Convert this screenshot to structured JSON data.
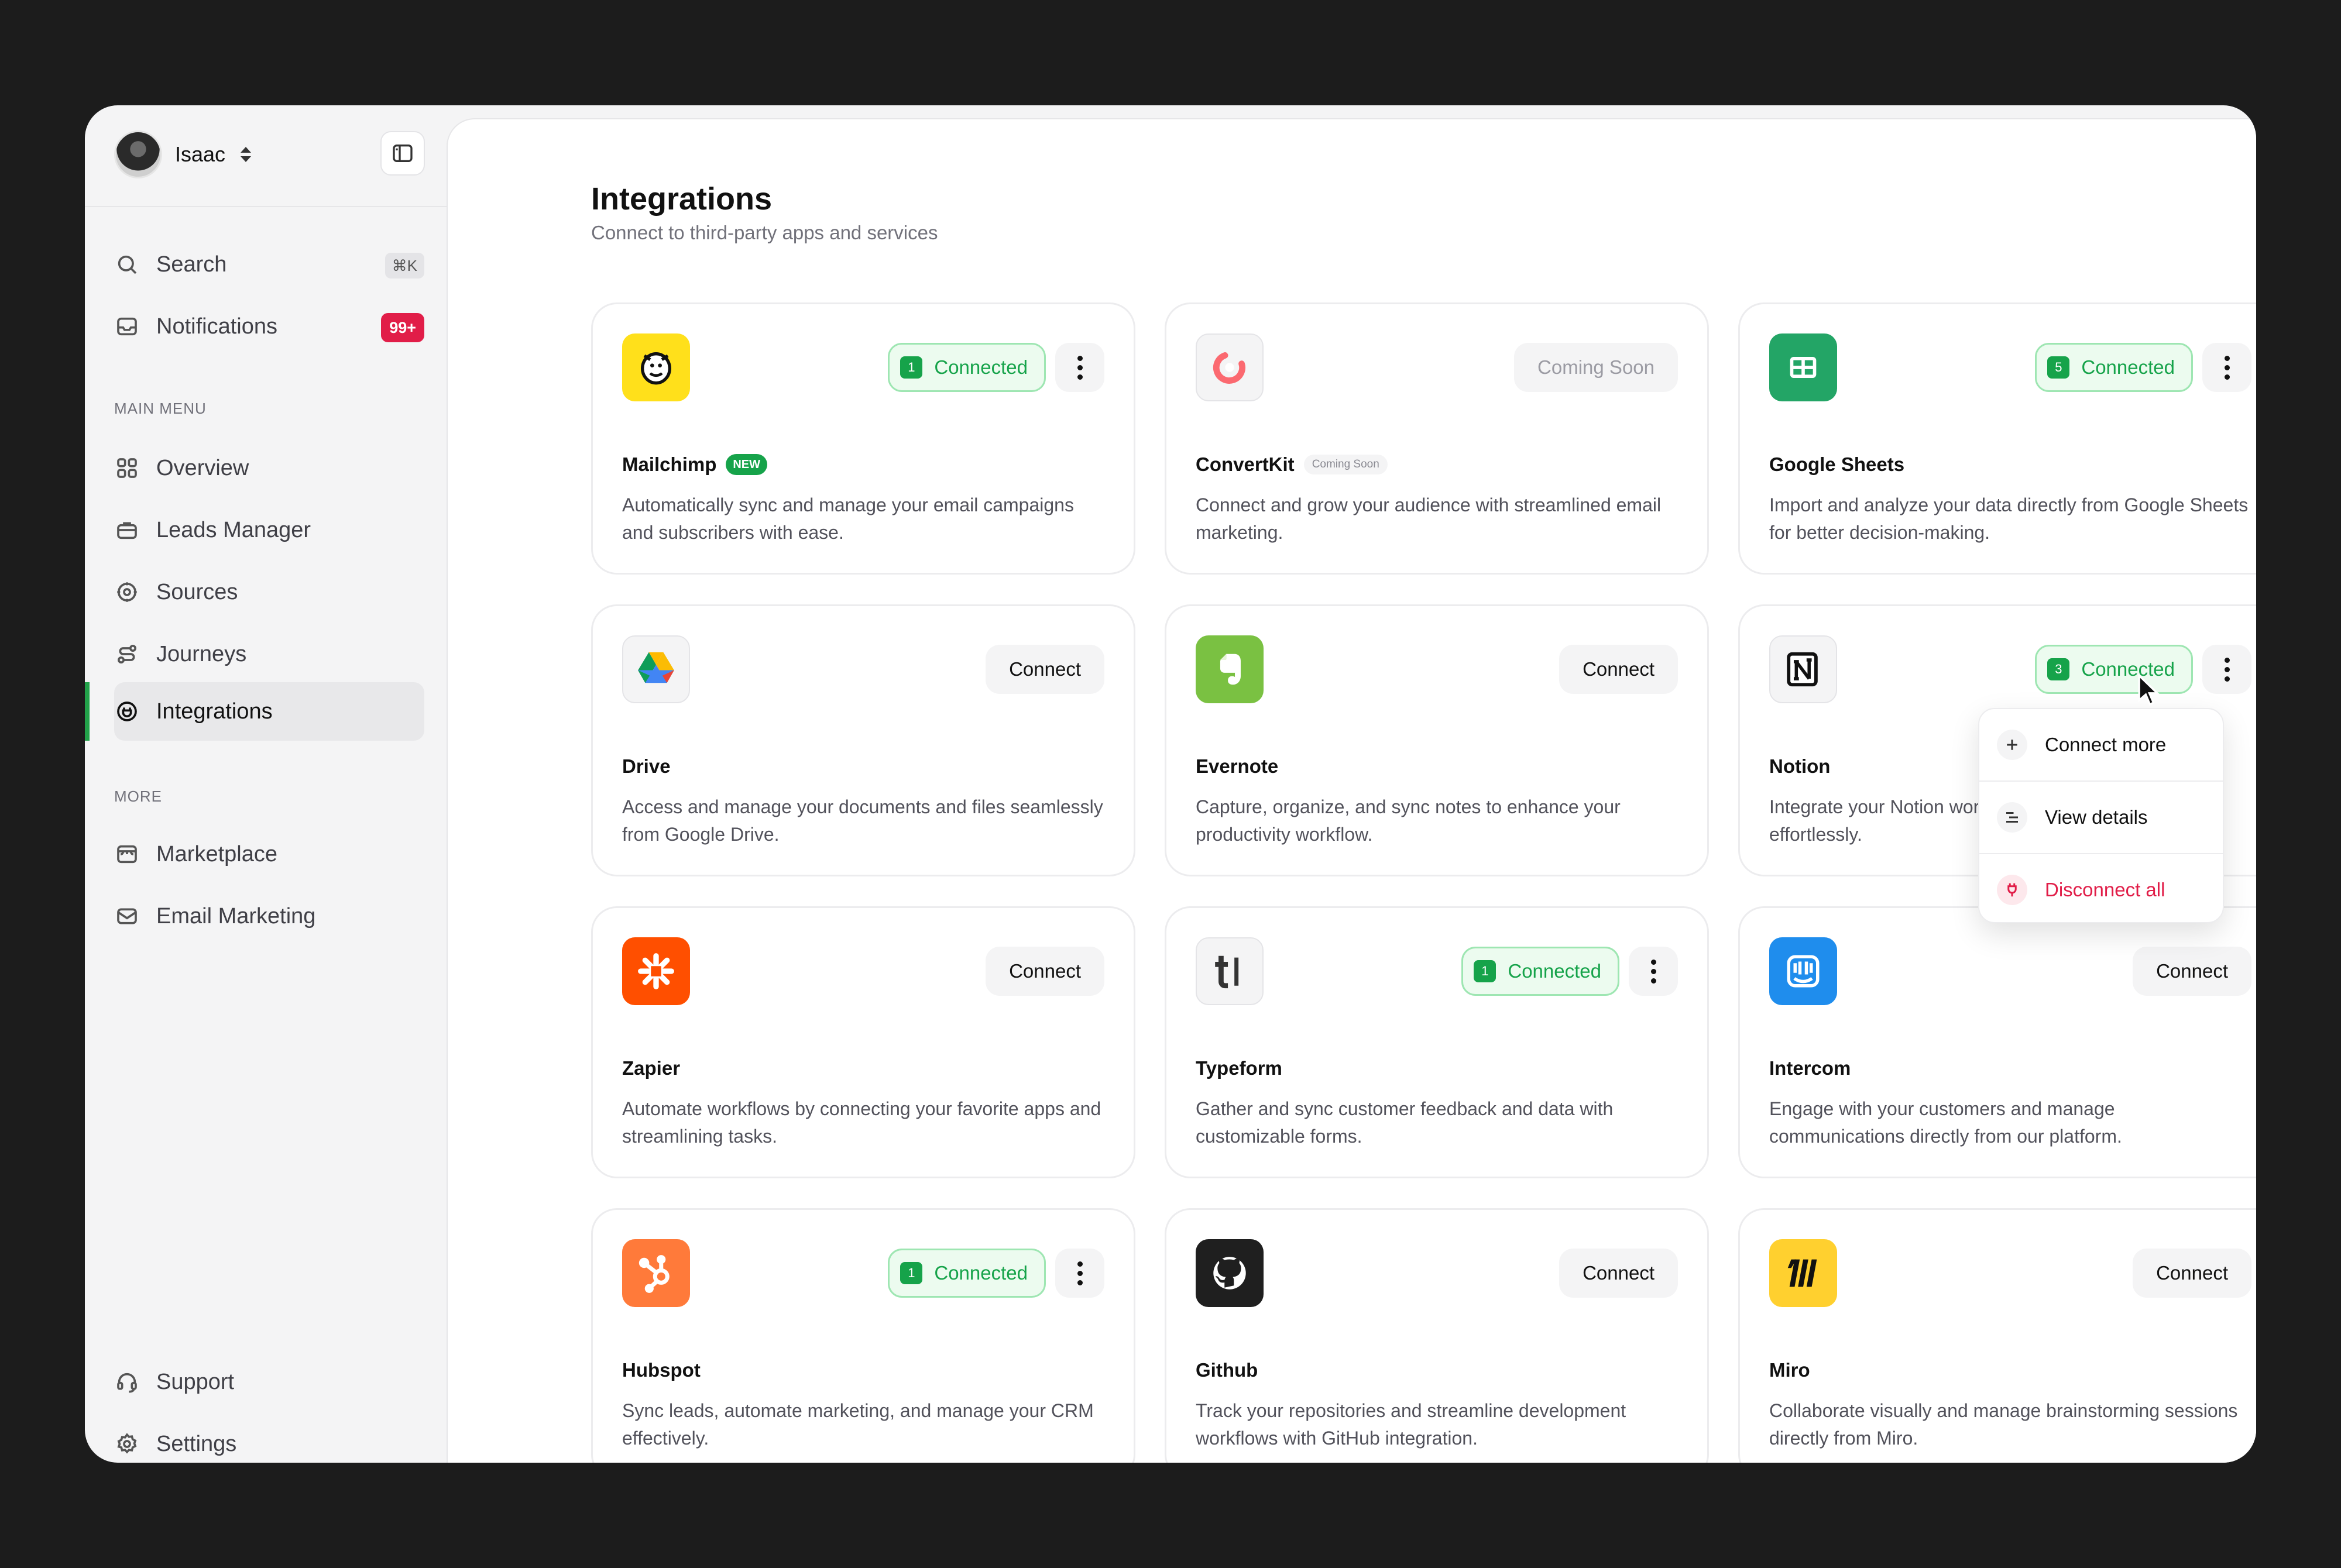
{
  "user": {
    "name": "Isaac"
  },
  "sidebar": {
    "search": {
      "label": "Search",
      "shortcut": "⌘K"
    },
    "notifications": {
      "label": "Notifications",
      "badge": "99+"
    },
    "main_menu_label": "MAIN MENU",
    "main_items": [
      {
        "label": "Overview",
        "icon": "grid-icon"
      },
      {
        "label": "Leads Manager",
        "icon": "briefcase-icon"
      },
      {
        "label": "Sources",
        "icon": "cog-badge-icon"
      },
      {
        "label": "Journeys",
        "icon": "route-icon"
      },
      {
        "label": "Integrations",
        "icon": "plug-circle-icon",
        "active": true
      }
    ],
    "more_label": "MORE",
    "more_items": [
      {
        "label": "Marketplace",
        "icon": "store-icon"
      },
      {
        "label": "Email Marketing",
        "icon": "mail-icon"
      }
    ],
    "bottom_items": [
      {
        "label": "Support",
        "icon": "headset-icon"
      },
      {
        "label": "Settings",
        "icon": "gear-icon"
      }
    ]
  },
  "page": {
    "title": "Integrations",
    "subtitle": "Connect to third-party apps and services"
  },
  "cards": [
    {
      "name": "Mailchimp",
      "tag": "NEW",
      "desc": "Automatically sync and manage your email campaigns and subscribers with ease.",
      "status": "connected",
      "count": "1",
      "status_label": "Connected",
      "color": "#FFE01B"
    },
    {
      "name": "ConvertKit",
      "tag": "Coming Soon",
      "desc": "Connect and grow your audience with streamlined email marketing.",
      "status": "soon",
      "status_label": "Coming Soon",
      "color": "#FB6970"
    },
    {
      "name": "Google Sheets",
      "desc": "Import and analyze your data directly from Google Sheets for better decision-making.",
      "status": "connected",
      "count": "5",
      "status_label": "Connected",
      "color": "#23A566"
    },
    {
      "name": "Drive",
      "desc": "Access and manage your documents and files seamlessly from Google Drive.",
      "status": "connect",
      "status_label": "Connect"
    },
    {
      "name": "Evernote",
      "desc": "Capture, organize, and sync notes to enhance your productivity workflow.",
      "status": "connect",
      "status_label": "Connect",
      "color": "#7AC142"
    },
    {
      "name": "Notion",
      "desc": "Integrate your Notion workspace to manage projects effortlessly.",
      "status": "connected",
      "count": "3",
      "status_label": "Connected"
    },
    {
      "name": "Zapier",
      "desc": "Automate workflows by connecting your favorite apps and streamlining tasks.",
      "status": "connect",
      "status_label": "Connect",
      "color": "#FF4F00"
    },
    {
      "name": "Typeform",
      "desc": "Gather and sync customer feedback and data with customizable forms.",
      "status": "connected",
      "count": "1",
      "status_label": "Connected"
    },
    {
      "name": "Intercom",
      "desc": "Engage with your customers and manage communications directly from our platform.",
      "status": "connect",
      "status_label": "Connect",
      "color": "#1F8DED"
    },
    {
      "name": "Hubspot",
      "desc": "Sync leads, automate marketing, and manage your CRM effectively.",
      "status": "connected",
      "count": "1",
      "status_label": "Connected",
      "color": "#FF7A3A"
    },
    {
      "name": "Github",
      "desc": "Track your repositories and streamline development workflows with GitHub integration.",
      "status": "connect",
      "status_label": "Connect",
      "color": "#1F1F1F"
    },
    {
      "name": "Miro",
      "desc": "Collaborate visually and manage brainstorming sessions directly from Miro.",
      "status": "connect",
      "status_label": "Connect",
      "color": "#FFD02F"
    }
  ],
  "menu": {
    "connect_more": "Connect more",
    "view_details": "View details",
    "disconnect_all": "Disconnect all"
  }
}
